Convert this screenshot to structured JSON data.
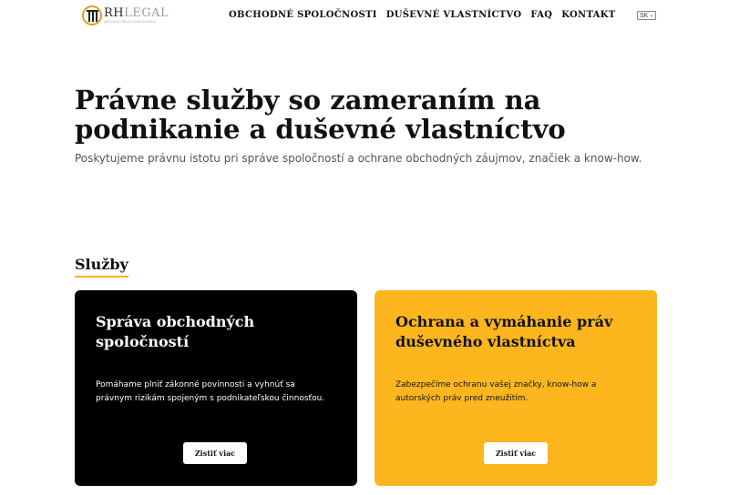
{
  "header": {
    "logo": {
      "name_main": "RH",
      "name_light": "LEGAL",
      "tagline": "ADVOKÁTSKA KANCELÁRIA"
    },
    "nav": [
      {
        "label": "OBCHODNÉ SPOLOČNOSTI"
      },
      {
        "label": "DUŠEVNÉ VLASTNÍCTVO"
      },
      {
        "label": "FAQ"
      },
      {
        "label": "KONTAKT"
      }
    ],
    "language": {
      "selected": "SK",
      "icon": "chevron-down-icon"
    }
  },
  "hero": {
    "title": "Právne služby so zameraním na podnikanie a duševné vlastníctvo",
    "subtitle": "Poskytujeme právnu istotu pri správe spoločností a ochrane obchodných záujmov, značiek a know-how."
  },
  "services": {
    "title": "Služby",
    "cards": [
      {
        "title": "Správa obchodných spoločností",
        "text": "Pomáhame plniť zákonné povinnosti a vyhnúť sa právnym rizikám spojeným s podnikateľskou činnosťou.",
        "button": "Zistiť viac"
      },
      {
        "title": "Ochrana a vymáhanie práv duševného vlastníctva",
        "text": "Zabezpečíme ochranu vašej značky, know-how a autorských práv pred zneužitím.",
        "button": "Zistiť viac"
      }
    ]
  },
  "colors": {
    "accent": "#fdb61d",
    "dark_card": "#000000",
    "text": "#111111",
    "muted": "#555555"
  }
}
